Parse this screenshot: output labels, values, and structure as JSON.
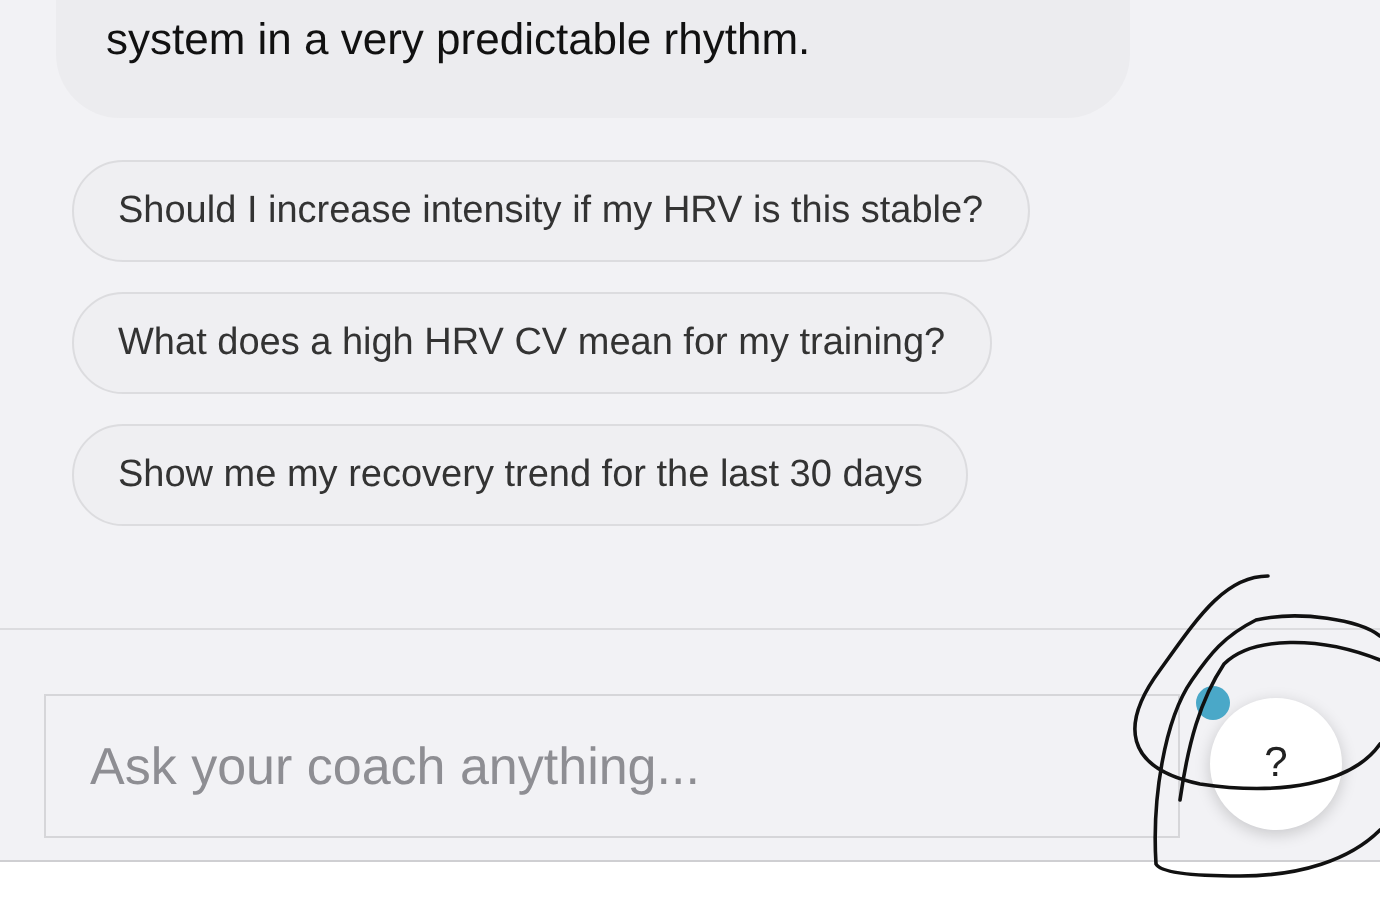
{
  "message": {
    "text": "system in a very predictable rhythm."
  },
  "suggestions": [
    {
      "label": "Should I increase intensity if my HRV is this stable?"
    },
    {
      "label": "What does a high HRV CV mean for my training?"
    },
    {
      "label": "Show me my recovery trend for the last 30 days"
    }
  ],
  "composer": {
    "placeholder": "Ask your coach anything..."
  },
  "help_button": {
    "label": "?",
    "badge": true
  }
}
